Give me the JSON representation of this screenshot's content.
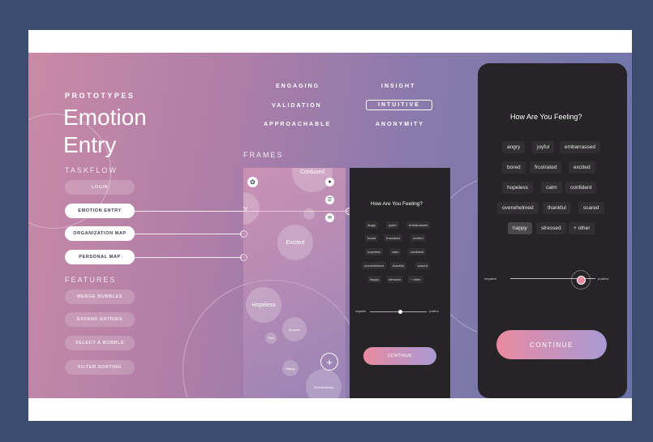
{
  "header": {
    "eyebrow": "PROTOTYPES",
    "title_line1": "Emotion",
    "title_line2": "Entry"
  },
  "principles": [
    "ENGAGING",
    "INSIGHT",
    "VALIDATION",
    "INTUITIVE",
    "APPROACHABLE",
    "ANONYMITY"
  ],
  "frames_label": "FRAMES",
  "taskflow": {
    "label": "TASKFLOW",
    "items": [
      "LOGIN",
      "EMOTION ENTRY",
      "ORGANIZATION MAP",
      "PERSONAL MAP"
    ]
  },
  "features": {
    "label": "FEATURES",
    "items": [
      "MERGE BUBBLES",
      "EXPAND ENTRIES",
      "SELECT A BUBBLE",
      "FILTER SORTING"
    ]
  },
  "bubble_frame": {
    "bubbles": [
      "Confused",
      "Excited",
      "Hopeless",
      "Anxious",
      "Tired",
      "Happy",
      "Overwhelmed",
      "gry"
    ]
  },
  "small_phone": {
    "question": "How Are You Feeling?",
    "emotions": [
      [
        "angry",
        "joyful",
        "embarrassed"
      ],
      [
        "bored",
        "frustrated",
        "excited"
      ],
      [
        "hopeless",
        "calm",
        "confident"
      ],
      [
        "overwhelmed",
        "thankful",
        "scared"
      ],
      [
        "happy",
        "stressed",
        "+ other"
      ]
    ],
    "scale_negative": "negative",
    "scale_positive": "positive",
    "continue_label": "CONTINUE"
  },
  "large_phone": {
    "question": "How Are You Feeling?",
    "emotions": [
      [
        "angry",
        "joyful",
        "embarrassed"
      ],
      [
        "bored",
        "frustrated",
        "excited"
      ],
      [
        "hopeless",
        "calm",
        "confident"
      ],
      [
        "overwhelmed",
        "thankful",
        "scared"
      ],
      [
        "happy",
        "stressed",
        "+ other"
      ]
    ],
    "selected_emotion": "happy",
    "scale_negative": "negative",
    "scale_positive": "positive",
    "scale_level": 0.82,
    "continue_label": "CONTINUE"
  },
  "colors": {
    "frame_background": "#3b4c6e",
    "phone_dark": "#262426",
    "button_gradient_start": "#e98aa0",
    "button_gradient_end": "#a89ad4"
  }
}
